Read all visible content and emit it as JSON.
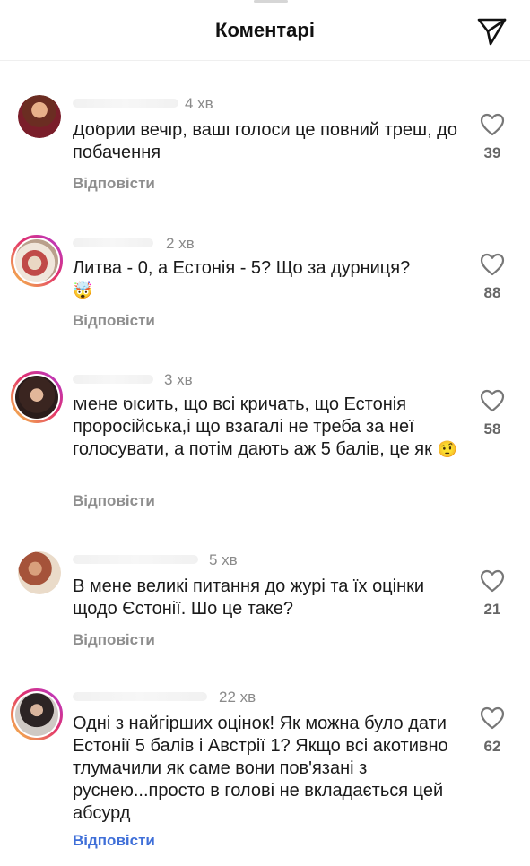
{
  "header": {
    "title": "Коментарі",
    "share_icon": "send-icon"
  },
  "comments": [
    {
      "time": "4 хв",
      "text": "Добрий вечір, ваші голоси це повний треш, до побачення",
      "reply": "Відповісти",
      "likes": "39",
      "avatar_story": false
    },
    {
      "time": "2 хв",
      "text": "Литва - 0, а Естонія - 5? Що за дурниця?",
      "emoji": "🤯",
      "reply": "Відповісти",
      "likes": "88",
      "avatar_story": true
    },
    {
      "time": "3 хв",
      "text": "Мене бісить, що всі кричать, що Естонія проросійська,і що взагалі не треба за неї голосувати, а потім дають аж 5 балів, це як",
      "emoji": "🤨",
      "reply": "Відповісти",
      "likes": "58",
      "avatar_story": true
    },
    {
      "time": "5 хв",
      "text": "В мене великі питання до журі та їх оцінки щодо Єстонії. Шо це таке?",
      "reply": "Відповісти",
      "likes": "21",
      "avatar_story": false
    },
    {
      "time": "22 хв",
      "text": "Одні з найгірших оцінок! Як можна було дати Естонії 5 балів і Австрії 1? Якщо всі акотивно тлумачили як саме вони пов'язані з руснею...просто в голові не вкладається цей абсурд",
      "reply": "Відповісти",
      "likes": "62",
      "avatar_story": true
    }
  ],
  "colors": {
    "reply_active": "#3f6fd8",
    "reply": "#8e8e8e",
    "story_ring": "#e1306c"
  }
}
